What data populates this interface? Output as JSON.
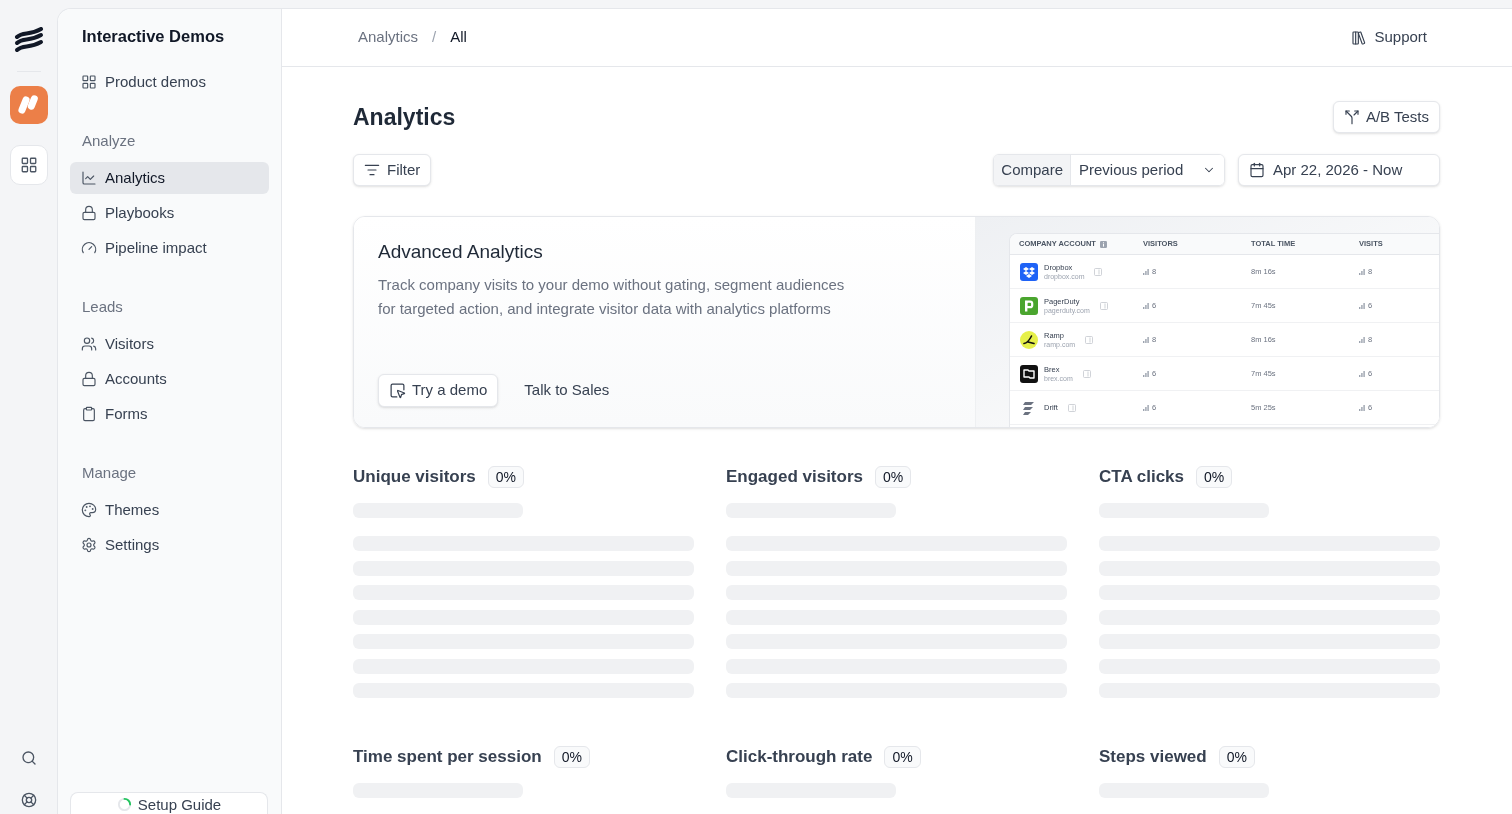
{
  "sidebar": {
    "title": "Interactive Demos",
    "sections": [
      {
        "items": [
          {
            "label": "Product demos",
            "selected": false
          }
        ]
      },
      {
        "heading": "Analyze",
        "items": [
          {
            "label": "Analytics",
            "selected": true
          },
          {
            "label": "Playbooks",
            "selected": false
          },
          {
            "label": "Pipeline impact",
            "selected": false
          }
        ]
      },
      {
        "heading": "Leads",
        "items": [
          {
            "label": "Visitors",
            "selected": false
          },
          {
            "label": "Accounts",
            "selected": false
          },
          {
            "label": "Forms",
            "selected": false
          }
        ]
      },
      {
        "heading": "Manage",
        "items": [
          {
            "label": "Themes",
            "selected": false
          },
          {
            "label": "Settings",
            "selected": false
          }
        ]
      }
    ],
    "setup_guide": "Setup Guide"
  },
  "breadcrumb": {
    "separator": "/",
    "items": [
      {
        "label": "Analytics",
        "current": false
      },
      {
        "label": "All",
        "current": true
      }
    ]
  },
  "header": {
    "support": "Support"
  },
  "page": {
    "title": "Analytics",
    "ab_tests": "A/B Tests",
    "filter": "Filter",
    "compare": {
      "label": "Compare",
      "value": "Previous period"
    },
    "date_range": "Apr 22, 2026 - Now"
  },
  "promo": {
    "title": "Advanced Analytics",
    "description": "Track company visits to your demo without gating, segment audiences for targeted action, and integrate visitor data with analytics platforms",
    "primary_button": "Try a demo",
    "secondary_button": "Talk to Sales",
    "preview": {
      "columns": [
        "COMPANY ACCOUNT",
        "VISITORS",
        "TOTAL TIME",
        "VISITS"
      ],
      "rows": [
        {
          "name": "Dropbox",
          "domain": "dropbox.com",
          "visitors": "8",
          "total_time": "8m 16s",
          "visits": "8"
        },
        {
          "name": "PagerDuty",
          "domain": "pagerduty.com",
          "visitors": "6",
          "total_time": "7m 45s",
          "visits": "6"
        },
        {
          "name": "Ramp",
          "domain": "ramp.com",
          "visitors": "8",
          "total_time": "8m 16s",
          "visits": "8"
        },
        {
          "name": "Brex",
          "domain": "brex.com",
          "visitors": "6",
          "total_time": "7m 45s",
          "visits": "6"
        },
        {
          "name": "Drift",
          "visitors": "6",
          "total_time": "5m 25s",
          "visits": "6"
        }
      ]
    }
  },
  "metrics": [
    {
      "title": "Unique visitors",
      "change": "0%",
      "loading": true
    },
    {
      "title": "Engaged visitors",
      "change": "0%",
      "loading": true
    },
    {
      "title": "CTA clicks",
      "change": "0%",
      "loading": true
    },
    {
      "title": "Time spent per session",
      "change": "0%",
      "loading": true
    },
    {
      "title": "Click-through rate",
      "change": "0%",
      "loading": true
    },
    {
      "title": "Steps viewed",
      "change": "0%",
      "loading": true
    }
  ]
}
